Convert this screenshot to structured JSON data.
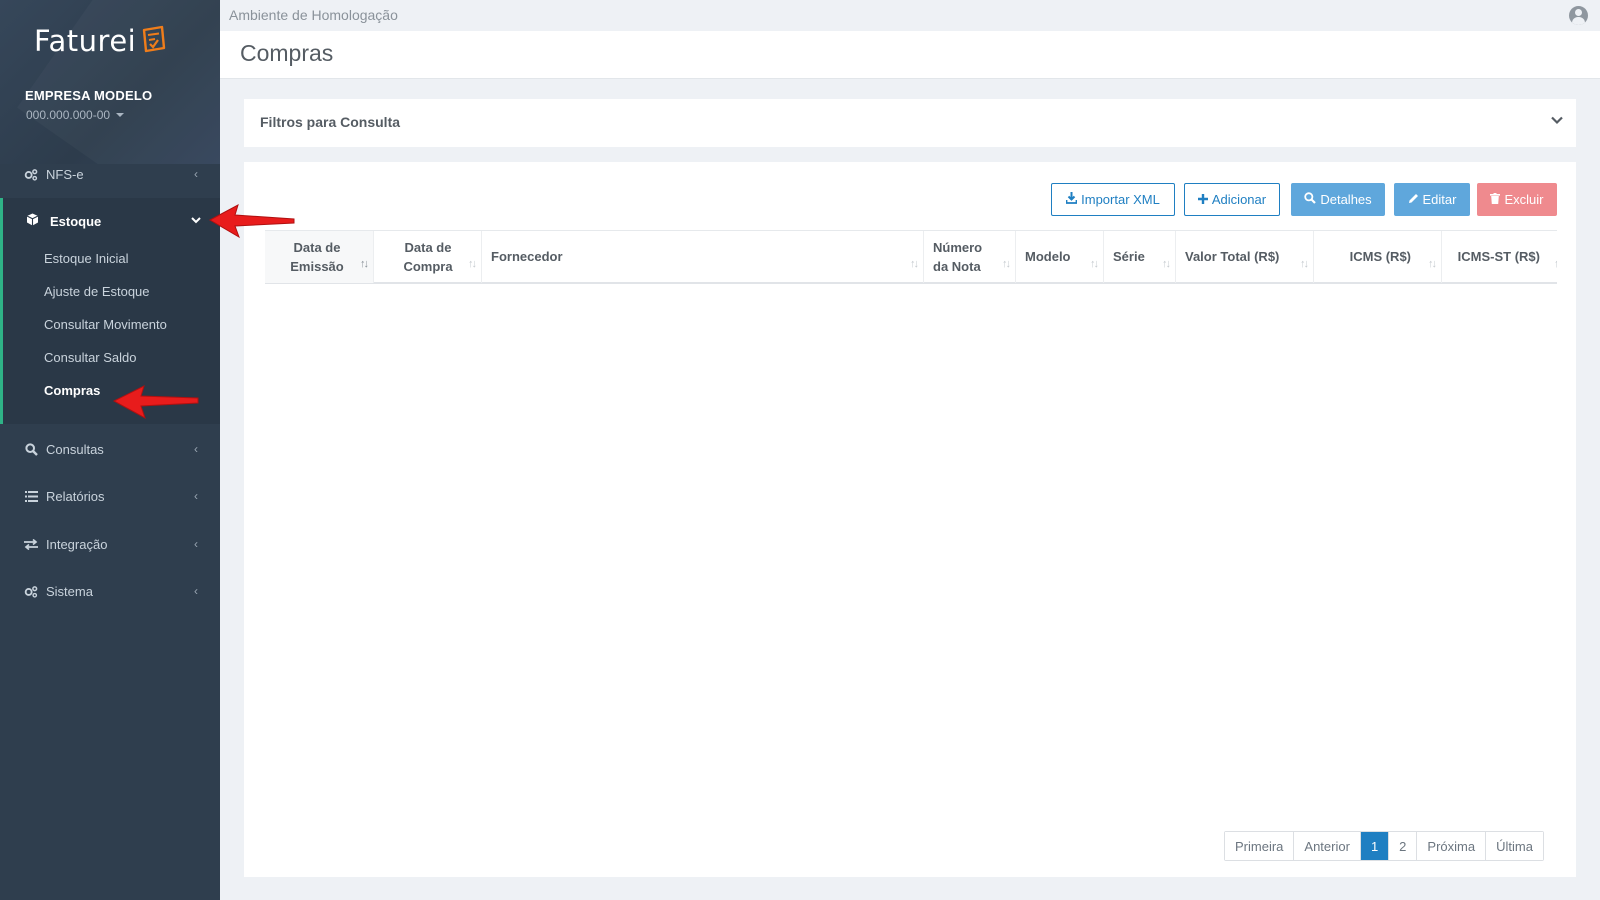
{
  "colors": {
    "sidebar_bg": "#2f3e4e",
    "accent_green": "#2fb387",
    "primary": "#1f7fc2",
    "info": "#5fa7dc",
    "danger": "#ef8a8e",
    "annotation_arrow": "#e81c1c"
  },
  "brand": {
    "logo_text": "Faturei"
  },
  "company": {
    "name": "EMPRESA MODELO",
    "cnpj": "000.000.000-00"
  },
  "sidebar": {
    "items": [
      {
        "label": "NFS-e",
        "icon": "gears-icon"
      },
      {
        "label": "Estoque",
        "icon": "box-icon",
        "expanded": true
      },
      {
        "label": "Consultas",
        "icon": "search-icon"
      },
      {
        "label": "Relatórios",
        "icon": "list-icon"
      },
      {
        "label": "Integração",
        "icon": "exchange-icon"
      },
      {
        "label": "Sistema",
        "icon": "gears-icon"
      }
    ],
    "estoque_sub": [
      {
        "label": "Estoque Inicial"
      },
      {
        "label": "Ajuste de Estoque"
      },
      {
        "label": "Consultar Movimento"
      },
      {
        "label": "Consultar Saldo"
      },
      {
        "label": "Compras",
        "active": true
      }
    ]
  },
  "header": {
    "environment": "Ambiente de Homologação",
    "page_title": "Compras"
  },
  "filters": {
    "title": "Filtros para Consulta"
  },
  "toolbar": {
    "import_xml": "Importar XML",
    "add": "Adicionar",
    "details": "Detalhes",
    "edit": "Editar",
    "delete": "Excluir"
  },
  "table": {
    "columns": [
      {
        "line1": "Data de",
        "line2": "Emissão"
      },
      {
        "line1": "Data de",
        "line2": "Compra"
      },
      {
        "line1": "Fornecedor",
        "line2": ""
      },
      {
        "line1": "Número",
        "line2": "da Nota"
      },
      {
        "line1": "Modelo",
        "line2": ""
      },
      {
        "line1": "Série",
        "line2": ""
      },
      {
        "line1": "Valor Total (R$)",
        "line2": ""
      },
      {
        "line1": "ICMS (R$)",
        "line2": ""
      },
      {
        "line1": "ICMS-ST (R$)",
        "line2": ""
      }
    ],
    "rows": []
  },
  "pagination": {
    "first": "Primeira",
    "prev": "Anterior",
    "pages": [
      "1",
      "2"
    ],
    "current": "1",
    "next": "Próxima",
    "last": "Última"
  }
}
